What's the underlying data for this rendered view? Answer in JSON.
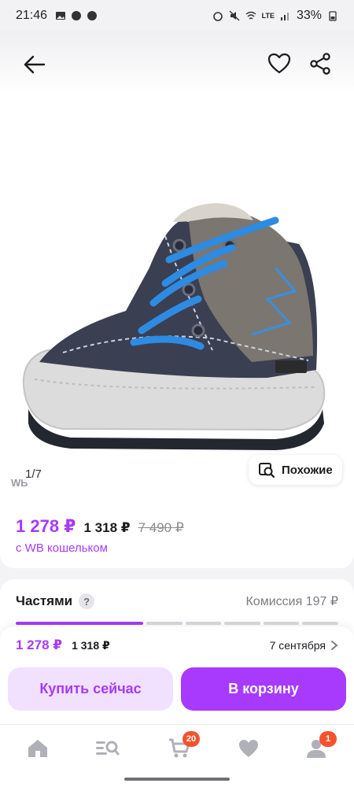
{
  "status_bar": {
    "time": "21:46",
    "battery": "33%",
    "network": "LTE"
  },
  "product": {
    "photo_counter": "1/7",
    "wb_mark": "WB",
    "similar_label": "Похожие"
  },
  "price": {
    "main": "1 278 ₽",
    "second": "1 318 ₽",
    "old": "7 490 ₽",
    "subtitle": "с WB кошельком"
  },
  "installments": {
    "title": "Частями",
    "help": "?",
    "commission": "Комиссия 197 ₽",
    "progress_active_segments": 1
  },
  "sheet": {
    "price_main": "1 278 ₽",
    "price_second": "1 318 ₽",
    "delivery_date": "7 сентября",
    "buy_now_label": "Купить сейчас",
    "add_to_cart_label": "В корзину"
  },
  "tab_bar": {
    "items": [
      {
        "name": "home",
        "badge": ""
      },
      {
        "name": "catalog",
        "badge": ""
      },
      {
        "name": "cart",
        "badge": "20"
      },
      {
        "name": "favorites",
        "badge": ""
      },
      {
        "name": "profile",
        "badge": "1"
      }
    ]
  },
  "colors": {
    "accent": "#a73afd",
    "accent_light": "#f1e1fe",
    "badge": "#f6522e"
  }
}
